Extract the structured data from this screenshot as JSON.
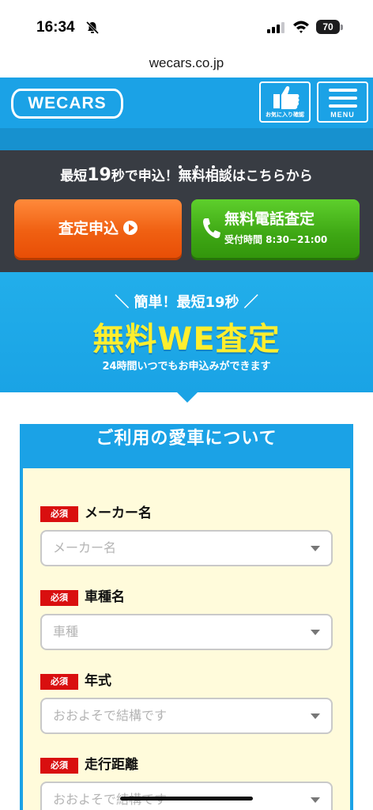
{
  "status_bar": {
    "time": "16:34",
    "battery": "70"
  },
  "browser": {
    "url": "wecars.co.jp"
  },
  "header": {
    "logo": "WECARS",
    "favorites_label": "お気に入り確認",
    "menu_label": "MENU"
  },
  "cta": {
    "heading_pre": "最短",
    "heading_num": "19",
    "heading_post": "秒で申込！無料相談はこちらから",
    "apply_button": "査定申込",
    "phone_button": "無料電話査定",
    "phone_hours": "受付時間 8:30−21:00"
  },
  "hero": {
    "tagline": "＼ 簡単！最短19秒 ／",
    "title": "無料WE査定",
    "subtitle": "24時間いつでもお申込みができます"
  },
  "form": {
    "title": "ご利用の愛車について",
    "required_label": "必須",
    "fields": [
      {
        "label": "メーカー名",
        "placeholder": "メーカー名"
      },
      {
        "label": "車種名",
        "placeholder": "車種"
      },
      {
        "label": "年式",
        "placeholder": "おおよそで結構です"
      },
      {
        "label": "走行距離",
        "placeholder": "おおよそで結構です"
      }
    ]
  },
  "colors": {
    "brand_blue": "#1ba2e6",
    "dark_band": "#383c43",
    "apply_orange": "#f06012",
    "phone_green": "#3ea714",
    "hero_yellow": "#ffee2e",
    "required_red": "#d90f0f",
    "form_bg": "#fffbdb"
  },
  "icons": [
    "bell-slash-icon",
    "signal-icon",
    "wifi-icon",
    "battery-icon",
    "thumbs-up-icon",
    "hamburger-menu-icon",
    "play-circle-icon",
    "phone-icon",
    "chevron-down-icon"
  ]
}
